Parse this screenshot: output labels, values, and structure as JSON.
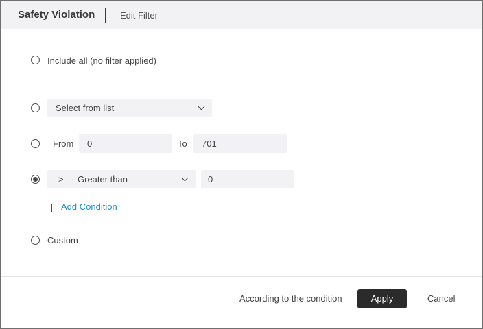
{
  "header": {
    "title": "Safety Violation",
    "subtitle": "Edit Filter"
  },
  "options": {
    "include_all": {
      "label": "Include all (no filter applied)",
      "selected": false
    },
    "list": {
      "selected_value": "Select from list",
      "selected": false
    },
    "range": {
      "from_label": "From",
      "from_value": "0",
      "to_label": "To",
      "to_value": "701",
      "selected": false
    },
    "condition": {
      "operator_symbol": ">",
      "operator_label": "Greater than",
      "value": "0",
      "selected": true,
      "add_label": "Add Condition"
    },
    "custom": {
      "label": "Custom",
      "selected": false
    }
  },
  "footer": {
    "summary": "According to the condition",
    "apply_label": "Apply",
    "cancel_label": "Cancel"
  },
  "colors": {
    "accent_link": "#1e8fc4",
    "primary_button": "#2b2b2b",
    "header_bg": "#f2f2f5"
  },
  "icons": [
    "chevron-down-icon",
    "plus-icon",
    "radio-icon"
  ]
}
